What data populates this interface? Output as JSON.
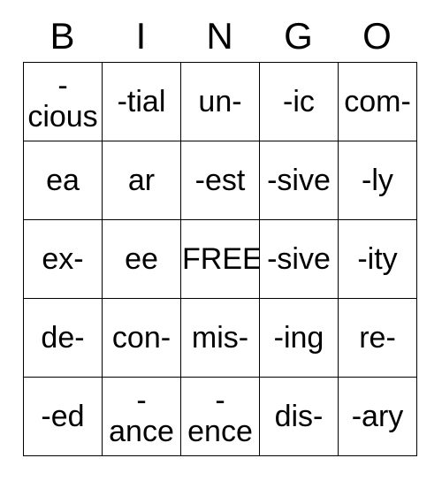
{
  "card": {
    "title_letters": [
      "B",
      "I",
      "N",
      "G",
      "O"
    ],
    "columns": 5,
    "rows": 5,
    "free_space_label": "FREE",
    "colors": {
      "background": "#ffffff",
      "cell_background": "#ffffff",
      "border": "#000000",
      "text": "#000000"
    },
    "grid": [
      [
        {
          "text": "-cious",
          "wrap": true
        },
        {
          "text": "-tial",
          "wrap": false
        },
        {
          "text": "un-",
          "wrap": false
        },
        {
          "text": "-ic",
          "wrap": false
        },
        {
          "text": "com-",
          "wrap": false
        }
      ],
      [
        {
          "text": "ea",
          "wrap": false
        },
        {
          "text": "ar",
          "wrap": false
        },
        {
          "text": "-est",
          "wrap": false
        },
        {
          "text": "-sive",
          "wrap": false
        },
        {
          "text": "-ly",
          "wrap": false
        }
      ],
      [
        {
          "text": "ex-",
          "wrap": false
        },
        {
          "text": "ee",
          "wrap": false
        },
        {
          "text": "FREE",
          "wrap": false
        },
        {
          "text": "-sive",
          "wrap": false
        },
        {
          "text": "-ity",
          "wrap": false
        }
      ],
      [
        {
          "text": "de-",
          "wrap": false
        },
        {
          "text": "con-",
          "wrap": false
        },
        {
          "text": "mis-",
          "wrap": false
        },
        {
          "text": "-ing",
          "wrap": false
        },
        {
          "text": "re-",
          "wrap": false
        }
      ],
      [
        {
          "text": "-ed",
          "wrap": false
        },
        {
          "text": "-ance",
          "wrap": true
        },
        {
          "text": "-ence",
          "wrap": true
        },
        {
          "text": "dis-",
          "wrap": false
        },
        {
          "text": "-ary",
          "wrap": false
        }
      ]
    ]
  }
}
